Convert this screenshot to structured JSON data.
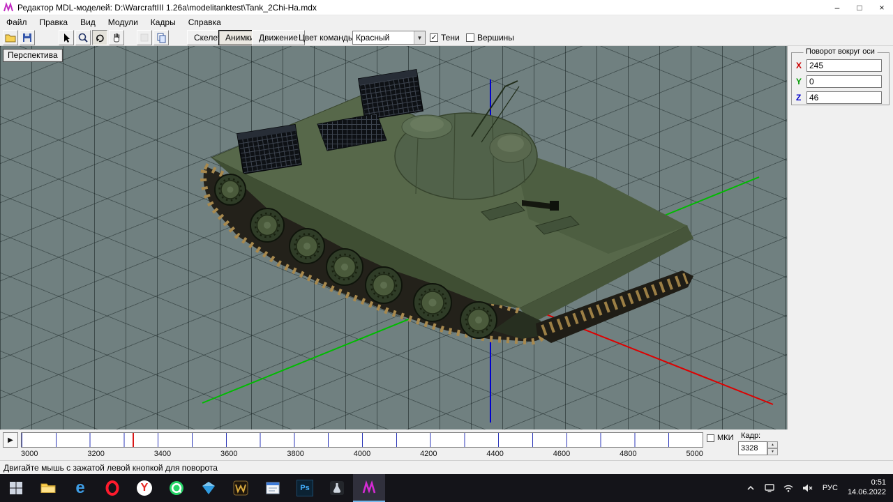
{
  "window": {
    "title": "Редактор MDL-моделей: D:\\WarcraftIII 1.26a\\modelitanktest\\Tank_2Chi-Ha.mdx",
    "controls": {
      "minimize": "–",
      "maximize": "□",
      "close": "×"
    }
  },
  "menu": {
    "items": [
      "Файл",
      "Правка",
      "Вид",
      "Модули",
      "Кадры",
      "Справка"
    ]
  },
  "toolbar": {
    "tabs": [
      {
        "label": "Скелет"
      },
      {
        "label": "Анимки"
      },
      {
        "label": "Движение"
      }
    ],
    "active_tab": "Анимки",
    "team_color_label": "Цвет команды:",
    "team_color_value": "Красный",
    "shadows_label": "Тени",
    "shadows_checked": true,
    "vertices_label": "Вершины",
    "vertices_checked": false
  },
  "viewport": {
    "label": "Перспектива",
    "axes": {
      "x_color": "#dd0000",
      "y_color": "#00bb00",
      "z_color": "#0000cc"
    }
  },
  "rotation_panel": {
    "title": "Поворот вокруг оси",
    "axes": [
      {
        "label": "X",
        "value": "245",
        "color": "#cc0000"
      },
      {
        "label": "Y",
        "value": "0",
        "color": "#009900"
      },
      {
        "label": "Z",
        "value": "46",
        "color": "#0000cc"
      }
    ]
  },
  "timeline": {
    "ruler_labels": [
      "3000",
      "3200",
      "3400",
      "3600",
      "3800",
      "4000",
      "4200",
      "4400",
      "4600",
      "4800",
      "5000"
    ],
    "range": [
      3000,
      5000
    ],
    "current_frame": "3328",
    "frame_label": "Кадр:",
    "mki_label": "МКИ"
  },
  "status_bar": {
    "text": "Двигайте мышь с зажатой левой кнопкой для поворота"
  },
  "glyphs": {
    "play": "▶",
    "combo_arrow": "▼",
    "spin_up": "▲",
    "spin_down": "▼",
    "check": "✓"
  },
  "taskbar": {
    "apps": [
      "start",
      "file-explorer",
      "edge",
      "opera",
      "yandex",
      "whatsapp",
      "gem-viewer",
      "warcraft",
      "document-viewer",
      "photoshop",
      "flask-tool",
      "mdl-editor"
    ],
    "active_app": "mdl-editor",
    "icon_letters": {
      "edge": "e",
      "yandex": "Y",
      "photoshop": "Ps"
    },
    "tray": {
      "language": "РУС",
      "time": "0:51",
      "date": "14.06.2022"
    }
  }
}
